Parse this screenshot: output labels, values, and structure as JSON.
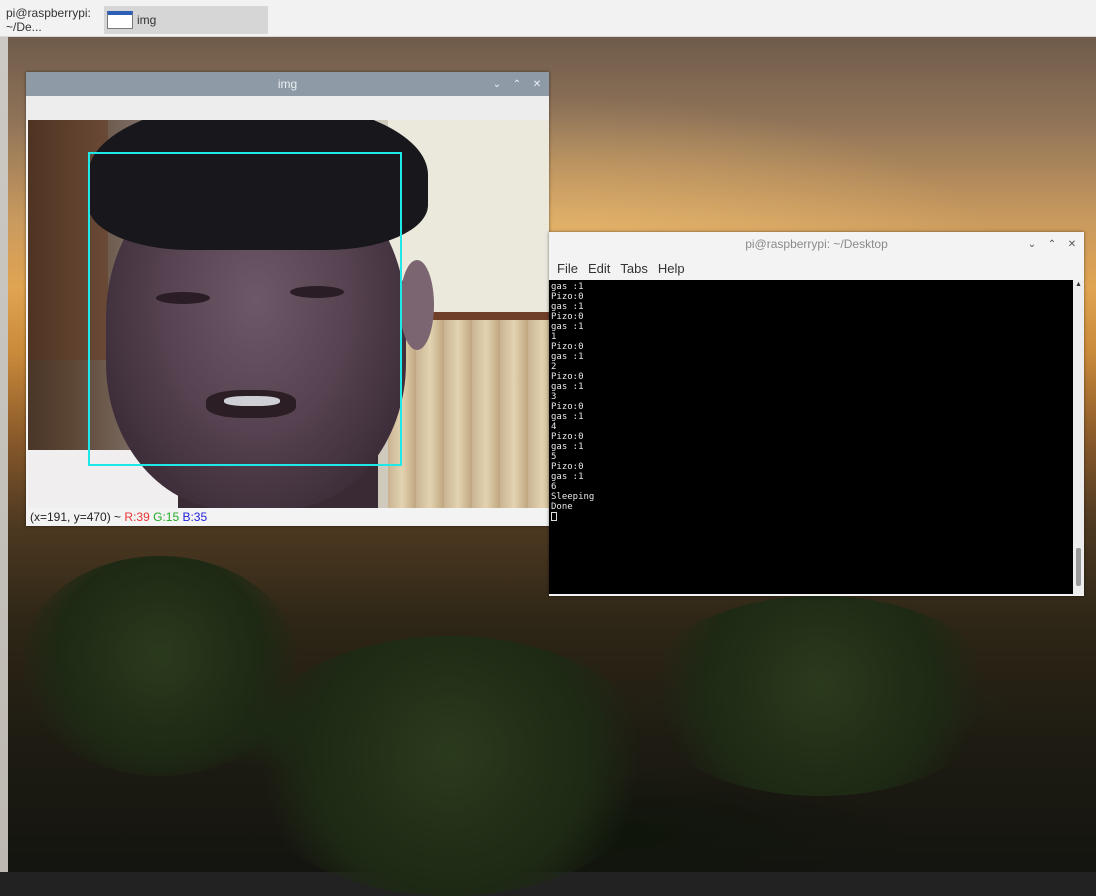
{
  "taskbar": {
    "items": [
      {
        "label": "pi@raspberrypi: ~/De..."
      },
      {
        "label": "img"
      }
    ]
  },
  "img_window": {
    "title": "img",
    "status": {
      "coords": "(x=191, y=470) ~",
      "r": "R:39",
      "g": "G:15",
      "b": "B:35"
    },
    "face_box_color": "#1ee8e8"
  },
  "terminal": {
    "title": "pi@raspberrypi: ~/Desktop",
    "menu": [
      "File",
      "Edit",
      "Tabs",
      "Help"
    ],
    "lines": [
      "gas :1",
      "Pizo:0",
      "gas :1",
      "Pizo:0",
      "gas :1",
      "1",
      "Pizo:0",
      "gas :1",
      "2",
      "Pizo:0",
      "gas :1",
      "3",
      "Pizo:0",
      "gas :1",
      "4",
      "Pizo:0",
      "gas :1",
      "5",
      "Pizo:0",
      "gas :1",
      "6",
      "Sleeping",
      "Done"
    ]
  },
  "icons": {
    "window_menu": "chevron-down-icon",
    "minimize": "minimize-icon",
    "close": "close-icon"
  }
}
